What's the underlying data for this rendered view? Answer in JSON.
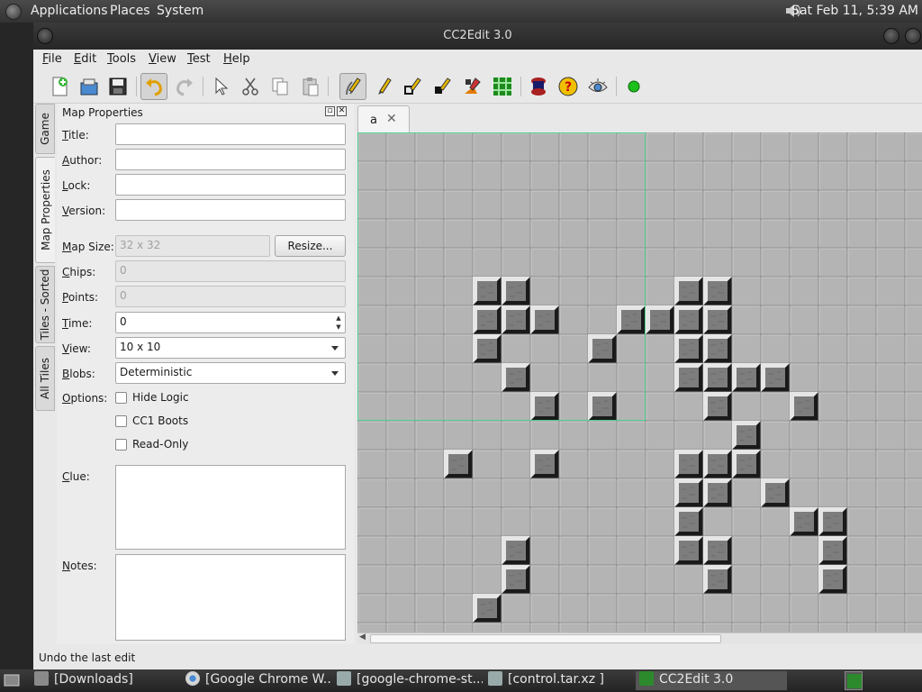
{
  "panel": {
    "menus": [
      "Applications",
      "Places",
      "System"
    ],
    "clock": "Sat Feb 11,  5:39 AM"
  },
  "window": {
    "title": "CC2Edit 3.0",
    "menu": [
      "File",
      "Edit",
      "Tools",
      "View",
      "Test",
      "Help"
    ],
    "toolbar_icons": [
      "new-map-icon",
      "open-icon",
      "save-icon",
      "undo-icon",
      "redo-icon",
      "select-icon",
      "cut-icon",
      "copy-icon",
      "paste-icon",
      "draw-icon",
      "pencil-icon",
      "line-icon",
      "fill-icon",
      "path-icon",
      "wire-icon",
      "chip-icon",
      "hint-icon",
      "visibility-icon",
      "test-play-icon"
    ]
  },
  "side_tabs": [
    "Game",
    "Map Properties",
    "Tiles - Sorted",
    "All Tiles"
  ],
  "map_properties": {
    "header": "Map Properties",
    "labels": {
      "title": "Title:",
      "author": "Author:",
      "lock": "Lock:",
      "version": "Version:",
      "map_size": "Map Size:",
      "chips": "Chips:",
      "points": "Points:",
      "time": "Time:",
      "view": "View:",
      "blobs": "Blobs:",
      "options": "Options:",
      "clue": "Clue:",
      "notes": "Notes:"
    },
    "values": {
      "title": "",
      "author": "",
      "lock": "",
      "version": "",
      "map_size": "32 x 32",
      "chips": "0",
      "points": "0",
      "time": "0",
      "view": "10 x 10",
      "blobs": "Deterministic"
    },
    "resize_button": "Resize...",
    "options": [
      {
        "label": "Hide Logic",
        "checked": false
      },
      {
        "label": "CC1 Boots",
        "checked": false
      },
      {
        "label": "Read-Only",
        "checked": false
      }
    ]
  },
  "editor": {
    "tab_label": "a",
    "close_glyph": "✕",
    "walls": [
      [
        4,
        5
      ],
      [
        5,
        5
      ],
      [
        11,
        5
      ],
      [
        12,
        5
      ],
      [
        4,
        6
      ],
      [
        5,
        6
      ],
      [
        6,
        6
      ],
      [
        9,
        6
      ],
      [
        10,
        6
      ],
      [
        11,
        6
      ],
      [
        12,
        6
      ],
      [
        4,
        7
      ],
      [
        8,
        7
      ],
      [
        11,
        7
      ],
      [
        12,
        7
      ],
      [
        5,
        8
      ],
      [
        11,
        8
      ],
      [
        12,
        8
      ],
      [
        13,
        8
      ],
      [
        14,
        8
      ],
      [
        6,
        9
      ],
      [
        8,
        9
      ],
      [
        12,
        9
      ],
      [
        15,
        9
      ],
      [
        13,
        10
      ],
      [
        3,
        11
      ],
      [
        6,
        11
      ],
      [
        11,
        11
      ],
      [
        12,
        11
      ],
      [
        13,
        11
      ],
      [
        11,
        12
      ],
      [
        12,
        12
      ],
      [
        14,
        12
      ],
      [
        11,
        13
      ],
      [
        15,
        13
      ],
      [
        16,
        13
      ],
      [
        5,
        14
      ],
      [
        11,
        14
      ],
      [
        12,
        14
      ],
      [
        16,
        14
      ],
      [
        5,
        15
      ],
      [
        12,
        15
      ],
      [
        16,
        15
      ],
      [
        4,
        16
      ]
    ],
    "viewport_cols": 10,
    "viewport_rows": 10
  },
  "status": "Undo the last edit",
  "taskbar": {
    "items": [
      "[Downloads]",
      "[Google Chrome W...",
      "[google-chrome-st...",
      "[control.tar.xz ]",
      "CC2Edit 3.0"
    ]
  }
}
